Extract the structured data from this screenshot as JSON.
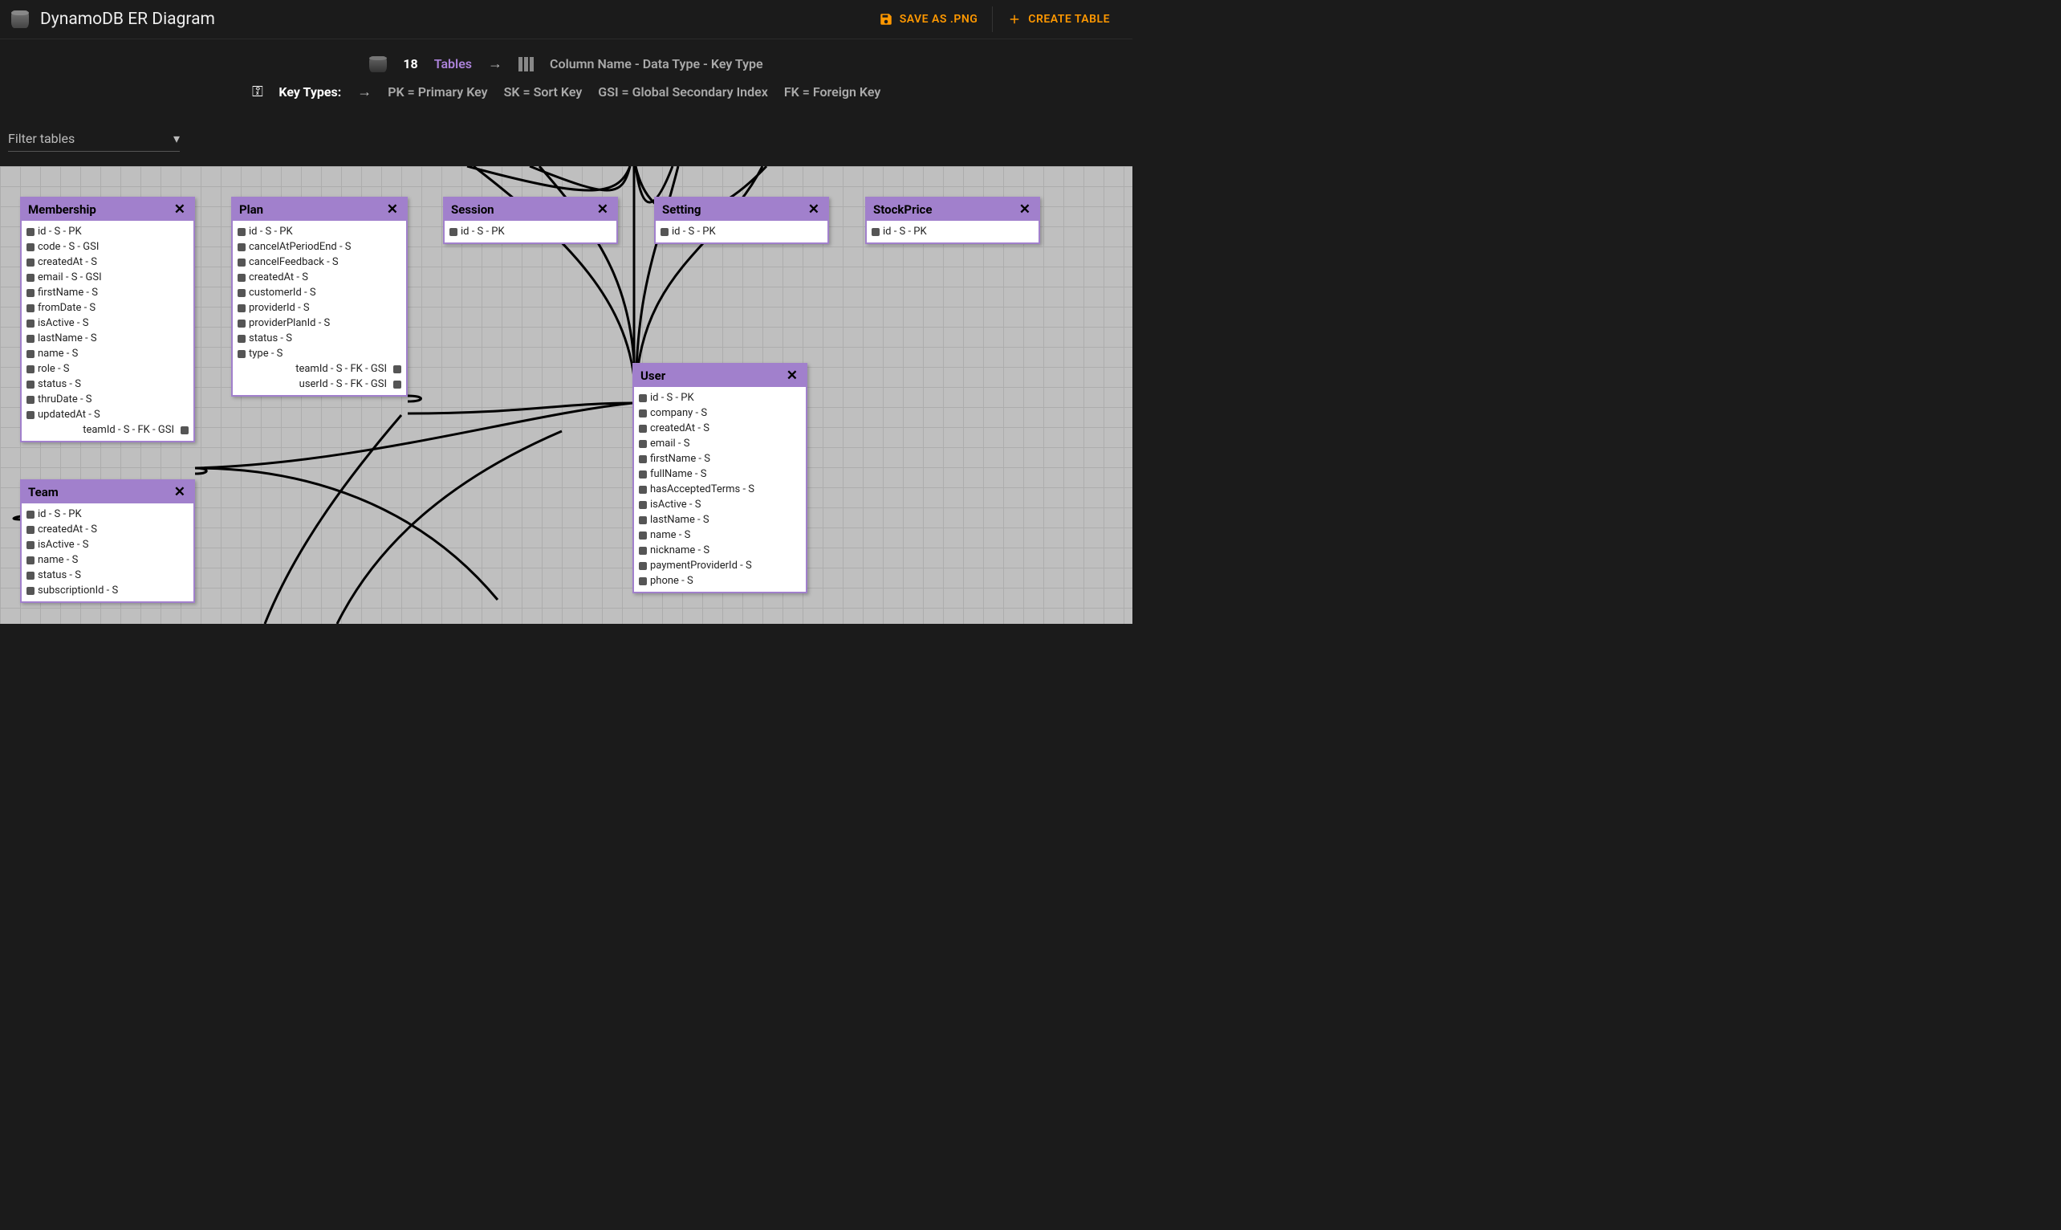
{
  "header": {
    "title": "DynamoDB ER Diagram",
    "save_label": "SAVE AS .PNG",
    "create_label": "CREATE TABLE"
  },
  "legend": {
    "count": "18",
    "tables_label": "Tables",
    "column_caption": "Column Name - Data Type - Key Type",
    "key_types_label": "Key Types:",
    "pk": "PK = Primary Key",
    "sk": "SK = Sort Key",
    "gsi": "GSI = Global Secondary Index",
    "fk": "FK = Foreign Key"
  },
  "filter": {
    "placeholder": "Filter tables"
  },
  "entities": {
    "membership": {
      "name": "Membership",
      "attrs": [
        "id - S - PK",
        "code - S - GSI",
        "createdAt - S",
        "email - S - GSI",
        "firstName - S",
        "fromDate - S",
        "isActive - S",
        "lastName - S",
        "name - S",
        "role - S",
        "status - S",
        "thruDate - S",
        "updatedAt - S"
      ],
      "right_attrs": [
        "teamId - S - FK - GSI"
      ]
    },
    "plan": {
      "name": "Plan",
      "attrs": [
        "id - S - PK",
        "cancelAtPeriodEnd - S",
        "cancelFeedback - S",
        "createdAt - S",
        "customerId - S",
        "providerId - S",
        "providerPlanId - S",
        "status - S",
        "type - S"
      ],
      "right_attrs": [
        "teamId - S - FK - GSI",
        "userId - S - FK - GSI"
      ]
    },
    "session": {
      "name": "Session",
      "attrs": [
        "id - S - PK"
      ],
      "right_attrs": []
    },
    "setting": {
      "name": "Setting",
      "attrs": [
        "id - S - PK"
      ],
      "right_attrs": []
    },
    "stock": {
      "name": "StockPrice",
      "attrs": [
        "id - S - PK"
      ],
      "right_attrs": []
    },
    "user": {
      "name": "User",
      "attrs": [
        "id - S - PK",
        "company - S",
        "createdAt - S",
        "email - S",
        "firstName - S",
        "fullName - S",
        "hasAcceptedTerms - S",
        "isActive - S",
        "lastName - S",
        "name - S",
        "nickname - S",
        "paymentProviderId - S",
        "phone - S"
      ],
      "right_attrs": []
    },
    "team": {
      "name": "Team",
      "attrs": [
        "id - S - PK",
        "createdAt - S",
        "isActive - S",
        "name - S",
        "status - S",
        "subscriptionId - S"
      ],
      "right_attrs": []
    }
  }
}
